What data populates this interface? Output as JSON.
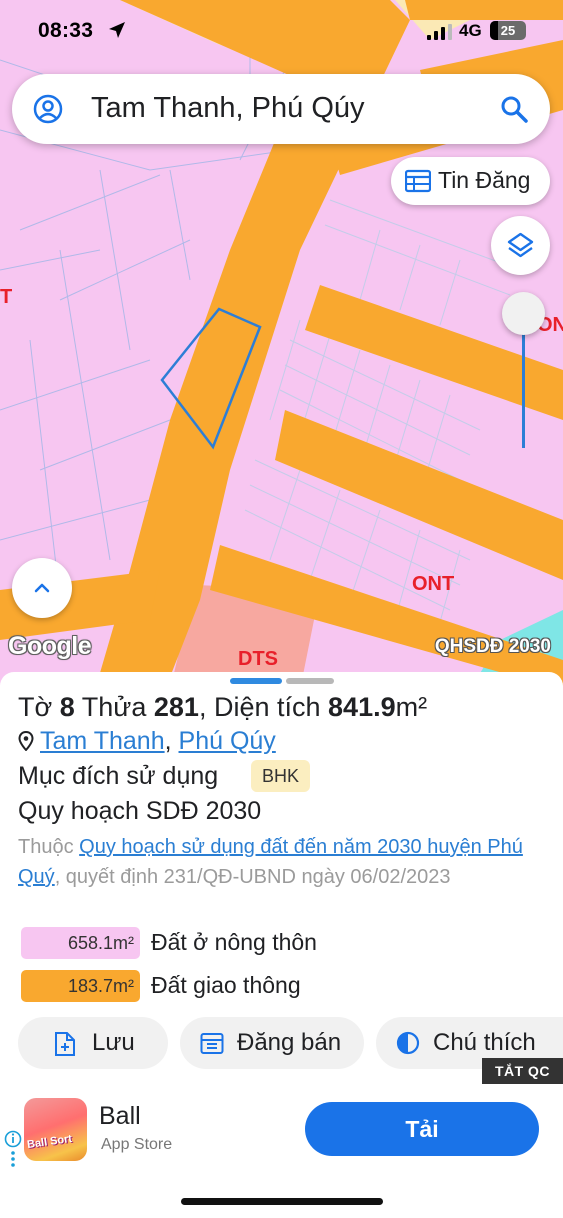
{
  "status": {
    "time": "08:33",
    "network": "4G",
    "battery": "25"
  },
  "search": {
    "query": "Tam Thanh, Phú Qúy"
  },
  "map": {
    "listing_button": "Tin Đăng",
    "zones": {
      "ont": "ONT",
      "dts": "DTS",
      "left_edge": "T",
      "right_edge": "ON"
    },
    "logo": "Google",
    "layer_label": "QHSDĐ 2030",
    "colors": {
      "residential": "#f7c6f1",
      "road": "#f9a82f",
      "parcel_outline": "#2d7ed6",
      "dts": "#f7a8a0",
      "yellow_zone": "#fbe9b5"
    }
  },
  "parcel": {
    "sheet_label": "Tờ",
    "sheet_no": "8",
    "plot_label": "Thửa",
    "plot_no": "281",
    "area_label": ", Diện tích",
    "area_value": "841.9",
    "area_unit": "m²",
    "commune": "Tam Thanh",
    "separator": ",",
    "district": "Phú Qúy",
    "purpose_label": "Mục đích sử dụng",
    "purpose_code": "BHK",
    "plan_title": "Quy hoạch SDĐ 2030",
    "plan_prefix": "Thuộc",
    "plan_link": "Quy hoạch sử dụng đất đến năm 2030 huyện Phú Quý",
    "plan_suffix": ", quyết định 231/QĐ-UBND ngày 06/02/2023",
    "areas": [
      {
        "value": "658.1m²",
        "label": "Đất ở nông thôn",
        "color": "#f7c6f1"
      },
      {
        "value": "183.7m²",
        "label": "Đất giao thông",
        "color": "#f9a82f"
      }
    ]
  },
  "actions": {
    "save": "Lưu",
    "post_sale": "Đăng bán",
    "legend": "Chú thích"
  },
  "ad": {
    "close_label": "TẮT QC",
    "app_name": "Ball",
    "store": "App Store",
    "icon_text": "Ball Sort",
    "cta": "Tải"
  }
}
